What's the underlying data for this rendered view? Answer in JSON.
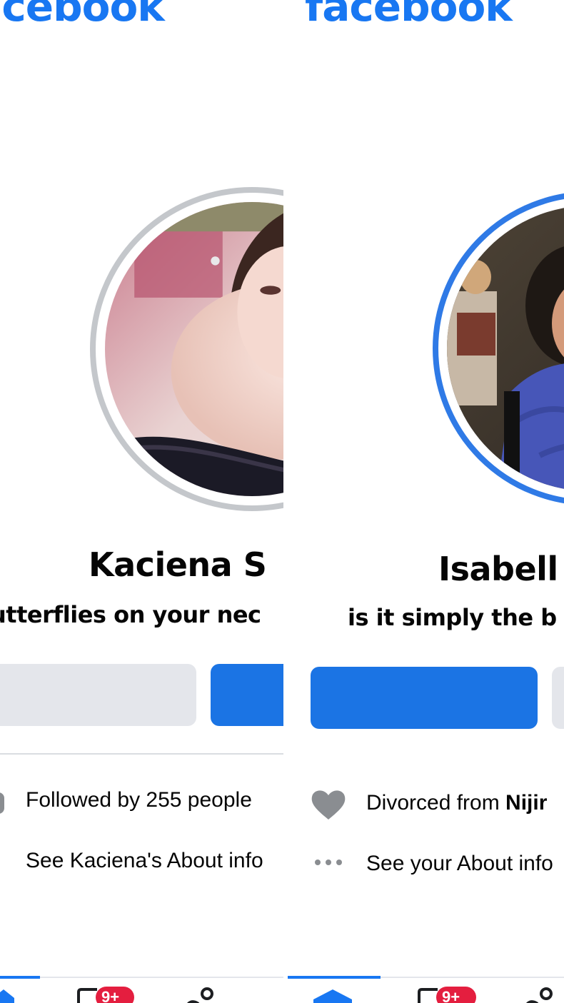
{
  "left_profile": {
    "logo": "facebook",
    "name": "Kaciena S",
    "bio": "utterflies on your nec",
    "info": {
      "followed_by": "Followed by 255 people",
      "about": "See Kaciena's About info"
    },
    "avatar_ring_color": "#c4c7cb",
    "nav": {
      "badge": "9+"
    }
  },
  "right_profile": {
    "logo": "facebook",
    "name": "Isabell",
    "bio": "is it simply the b",
    "info": {
      "relationship_prefix": "Divorced from ",
      "relationship_name": "Nijir",
      "about": "See your About info"
    },
    "avatar_ring_color": "#2f7ae6",
    "nav": {
      "badge": "9+"
    }
  },
  "colors": {
    "brand": "#1877f2",
    "primary_button": "#1b74e4",
    "secondary_button": "#e4e6eb",
    "badge": "#e41e3f"
  }
}
